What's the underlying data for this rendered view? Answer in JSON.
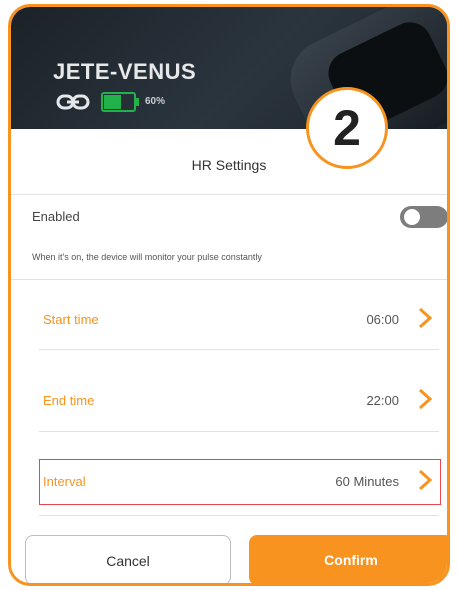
{
  "device": {
    "name": "JETE-VENUS",
    "battery": "60%",
    "battery_level": 0.6
  },
  "step_number": "2",
  "settings": {
    "title": "HR Settings",
    "enabled_label": "Enabled",
    "enabled_on": false,
    "enabled_description": "When it's on, the device will monitor your pulse constantly"
  },
  "rows": [
    {
      "label": "Start time",
      "value": "06:00"
    },
    {
      "label": "End time",
      "value": "22:00"
    },
    {
      "label": "Interval",
      "value": "60 Minutes"
    }
  ],
  "buttons": {
    "cancel": "Cancel",
    "confirm": "Confirm"
  },
  "colors": {
    "accent": "#f7931e",
    "highlight": "#e8474f",
    "battery": "#22b24c"
  }
}
